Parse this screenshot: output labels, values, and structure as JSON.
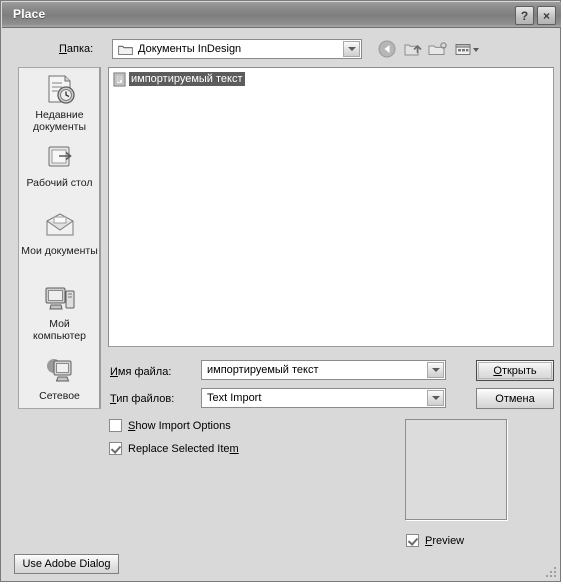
{
  "window": {
    "title": "Place",
    "help_button": "?",
    "close_button": "×"
  },
  "lookin": {
    "label": "Папка:",
    "value": "Документы InDesign",
    "folder_icon": "folder-icon",
    "dropdown_icon": "chevron-down-icon"
  },
  "toolbar": {
    "back_icon": "back-arrow-icon",
    "up_icon": "up-one-level-icon",
    "new_folder_icon": "new-folder-icon",
    "views_icon": "views-menu-icon"
  },
  "places": {
    "items": [
      {
        "label_line1": "Недавние",
        "label_line2": "документы",
        "icon": "recent-documents-icon"
      },
      {
        "label_line1": "Рабочий стол",
        "label_line2": "",
        "icon": "desktop-icon"
      },
      {
        "label_line1": "Мои документы",
        "label_line2": "",
        "icon": "my-documents-icon"
      },
      {
        "label_line1": "Мой",
        "label_line2": "компьютер",
        "icon": "my-computer-icon"
      },
      {
        "label_line1": "Сетевое",
        "label_line2": "",
        "icon": "network-places-icon"
      }
    ]
  },
  "filelist": {
    "selected_file": "импортируемый текст",
    "file_icon": "text-document-icon",
    "selection_color": "#5c5c5c"
  },
  "fields": {
    "filename_label": "Имя файла:",
    "filename_label_mnemonic": "И",
    "filename_label_rest": "мя файла:",
    "filename_value": "импортируемый текст",
    "filetype_label_mnemonic": "Т",
    "filetype_label_rest": "ип файлов:",
    "filetype_value": "Text Import"
  },
  "buttons": {
    "open_mnemonic": "О",
    "open_rest": "ткрыть",
    "cancel": "Отмена",
    "use_adobe_dialog": "Use Adobe Dialog"
  },
  "options": {
    "show_import_options": {
      "mnemonic": "S",
      "rest": "how Import Options",
      "checked": false
    },
    "replace_selected_item": {
      "prefix": "Replace Selected Ite",
      "mnemonic": "m",
      "checked": true
    },
    "preview": {
      "mnemonic": "P",
      "rest": "review",
      "checked": true
    }
  }
}
